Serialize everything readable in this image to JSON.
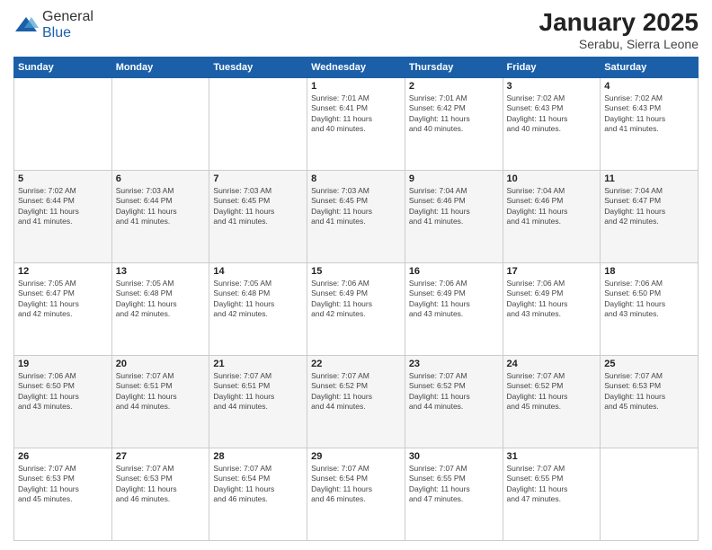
{
  "logo": {
    "general": "General",
    "blue": "Blue"
  },
  "header": {
    "month_title": "January 2025",
    "location": "Serabu, Sierra Leone"
  },
  "days_of_week": [
    "Sunday",
    "Monday",
    "Tuesday",
    "Wednesday",
    "Thursday",
    "Friday",
    "Saturday"
  ],
  "weeks": [
    [
      {
        "day": "",
        "info": ""
      },
      {
        "day": "",
        "info": ""
      },
      {
        "day": "",
        "info": ""
      },
      {
        "day": "1",
        "info": "Sunrise: 7:01 AM\nSunset: 6:41 PM\nDaylight: 11 hours\nand 40 minutes."
      },
      {
        "day": "2",
        "info": "Sunrise: 7:01 AM\nSunset: 6:42 PM\nDaylight: 11 hours\nand 40 minutes."
      },
      {
        "day": "3",
        "info": "Sunrise: 7:02 AM\nSunset: 6:43 PM\nDaylight: 11 hours\nand 40 minutes."
      },
      {
        "day": "4",
        "info": "Sunrise: 7:02 AM\nSunset: 6:43 PM\nDaylight: 11 hours\nand 41 minutes."
      }
    ],
    [
      {
        "day": "5",
        "info": "Sunrise: 7:02 AM\nSunset: 6:44 PM\nDaylight: 11 hours\nand 41 minutes."
      },
      {
        "day": "6",
        "info": "Sunrise: 7:03 AM\nSunset: 6:44 PM\nDaylight: 11 hours\nand 41 minutes."
      },
      {
        "day": "7",
        "info": "Sunrise: 7:03 AM\nSunset: 6:45 PM\nDaylight: 11 hours\nand 41 minutes."
      },
      {
        "day": "8",
        "info": "Sunrise: 7:03 AM\nSunset: 6:45 PM\nDaylight: 11 hours\nand 41 minutes."
      },
      {
        "day": "9",
        "info": "Sunrise: 7:04 AM\nSunset: 6:46 PM\nDaylight: 11 hours\nand 41 minutes."
      },
      {
        "day": "10",
        "info": "Sunrise: 7:04 AM\nSunset: 6:46 PM\nDaylight: 11 hours\nand 41 minutes."
      },
      {
        "day": "11",
        "info": "Sunrise: 7:04 AM\nSunset: 6:47 PM\nDaylight: 11 hours\nand 42 minutes."
      }
    ],
    [
      {
        "day": "12",
        "info": "Sunrise: 7:05 AM\nSunset: 6:47 PM\nDaylight: 11 hours\nand 42 minutes."
      },
      {
        "day": "13",
        "info": "Sunrise: 7:05 AM\nSunset: 6:48 PM\nDaylight: 11 hours\nand 42 minutes."
      },
      {
        "day": "14",
        "info": "Sunrise: 7:05 AM\nSunset: 6:48 PM\nDaylight: 11 hours\nand 42 minutes."
      },
      {
        "day": "15",
        "info": "Sunrise: 7:06 AM\nSunset: 6:49 PM\nDaylight: 11 hours\nand 42 minutes."
      },
      {
        "day": "16",
        "info": "Sunrise: 7:06 AM\nSunset: 6:49 PM\nDaylight: 11 hours\nand 43 minutes."
      },
      {
        "day": "17",
        "info": "Sunrise: 7:06 AM\nSunset: 6:49 PM\nDaylight: 11 hours\nand 43 minutes."
      },
      {
        "day": "18",
        "info": "Sunrise: 7:06 AM\nSunset: 6:50 PM\nDaylight: 11 hours\nand 43 minutes."
      }
    ],
    [
      {
        "day": "19",
        "info": "Sunrise: 7:06 AM\nSunset: 6:50 PM\nDaylight: 11 hours\nand 43 minutes."
      },
      {
        "day": "20",
        "info": "Sunrise: 7:07 AM\nSunset: 6:51 PM\nDaylight: 11 hours\nand 44 minutes."
      },
      {
        "day": "21",
        "info": "Sunrise: 7:07 AM\nSunset: 6:51 PM\nDaylight: 11 hours\nand 44 minutes."
      },
      {
        "day": "22",
        "info": "Sunrise: 7:07 AM\nSunset: 6:52 PM\nDaylight: 11 hours\nand 44 minutes."
      },
      {
        "day": "23",
        "info": "Sunrise: 7:07 AM\nSunset: 6:52 PM\nDaylight: 11 hours\nand 44 minutes."
      },
      {
        "day": "24",
        "info": "Sunrise: 7:07 AM\nSunset: 6:52 PM\nDaylight: 11 hours\nand 45 minutes."
      },
      {
        "day": "25",
        "info": "Sunrise: 7:07 AM\nSunset: 6:53 PM\nDaylight: 11 hours\nand 45 minutes."
      }
    ],
    [
      {
        "day": "26",
        "info": "Sunrise: 7:07 AM\nSunset: 6:53 PM\nDaylight: 11 hours\nand 45 minutes."
      },
      {
        "day": "27",
        "info": "Sunrise: 7:07 AM\nSunset: 6:53 PM\nDaylight: 11 hours\nand 46 minutes."
      },
      {
        "day": "28",
        "info": "Sunrise: 7:07 AM\nSunset: 6:54 PM\nDaylight: 11 hours\nand 46 minutes."
      },
      {
        "day": "29",
        "info": "Sunrise: 7:07 AM\nSunset: 6:54 PM\nDaylight: 11 hours\nand 46 minutes."
      },
      {
        "day": "30",
        "info": "Sunrise: 7:07 AM\nSunset: 6:55 PM\nDaylight: 11 hours\nand 47 minutes."
      },
      {
        "day": "31",
        "info": "Sunrise: 7:07 AM\nSunset: 6:55 PM\nDaylight: 11 hours\nand 47 minutes."
      },
      {
        "day": "",
        "info": ""
      }
    ]
  ]
}
